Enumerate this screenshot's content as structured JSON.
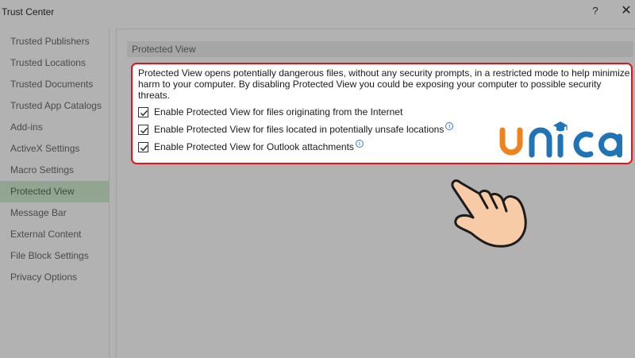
{
  "window": {
    "title": "Trust Center",
    "help_glyph": "?",
    "close_glyph": "✕"
  },
  "sidebar": {
    "items": [
      {
        "label": "Trusted Publishers"
      },
      {
        "label": "Trusted Locations"
      },
      {
        "label": "Trusted Documents"
      },
      {
        "label": "Trusted App Catalogs"
      },
      {
        "label": "Add-ins"
      },
      {
        "label": "ActiveX Settings"
      },
      {
        "label": "Macro Settings"
      },
      {
        "label": "Protected View",
        "selected": true
      },
      {
        "label": "Message Bar"
      },
      {
        "label": "External Content"
      },
      {
        "label": "File Block Settings"
      },
      {
        "label": "Privacy Options"
      }
    ]
  },
  "main": {
    "section_title": "Protected View",
    "description": "Protected View opens potentially dangerous files, without any security prompts, in a restricted mode to help minimize harm to your computer. By disabling Protected View you could be exposing your computer to possible security threats.",
    "options": [
      {
        "label": "Enable Protected View for files originating from the Internet",
        "checked": true,
        "info": false
      },
      {
        "label": "Enable Protected View for files located in potentially unsafe locations",
        "checked": true,
        "info": true
      },
      {
        "label": "Enable Protected View for Outlook attachments",
        "checked": true,
        "info": true
      }
    ],
    "info_glyph": "i"
  },
  "overlay": {
    "logo_text": "unica",
    "logo_icon": "graduation-cap-icon",
    "pointer_icon": "pointing-hand-icon",
    "colors": {
      "highlight_border": "#e0141c",
      "logo_orange": "#f0821e",
      "logo_blue": "#1f74b8",
      "selected_item": "#92a592"
    }
  }
}
